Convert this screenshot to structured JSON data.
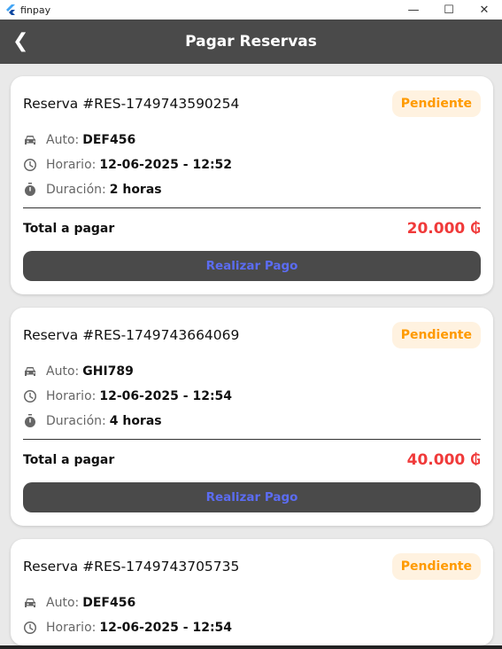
{
  "window": {
    "title": "finpay",
    "minimize": "—",
    "maximize": "☐",
    "close": "✕"
  },
  "appbar": {
    "title": "Pagar Reservas"
  },
  "labels": {
    "auto": "Auto:",
    "horario": "Horario:",
    "duracion": "Duración:",
    "total": "Total a pagar",
    "pay": "Realizar Pago"
  },
  "colors": {
    "appbar": "#4a4a4a",
    "badge_text": "#ff9a00",
    "total": "#f03a3a",
    "pay_text": "#5b6cf2"
  },
  "reservas": [
    {
      "id": "Reserva #RES-1749743590254",
      "status": "Pendiente",
      "auto": "DEF456",
      "horario": "12-06-2025 - 12:52",
      "duracion": "2 horas",
      "total": "20.000 ₲"
    },
    {
      "id": "Reserva #RES-1749743664069",
      "status": "Pendiente",
      "auto": "GHI789",
      "horario": "12-06-2025 - 12:54",
      "duracion": "4 horas",
      "total": "40.000 ₲"
    },
    {
      "id": "Reserva #RES-1749743705735",
      "status": "Pendiente",
      "auto": "DEF456",
      "horario": "12-06-2025 - 12:54"
    }
  ]
}
